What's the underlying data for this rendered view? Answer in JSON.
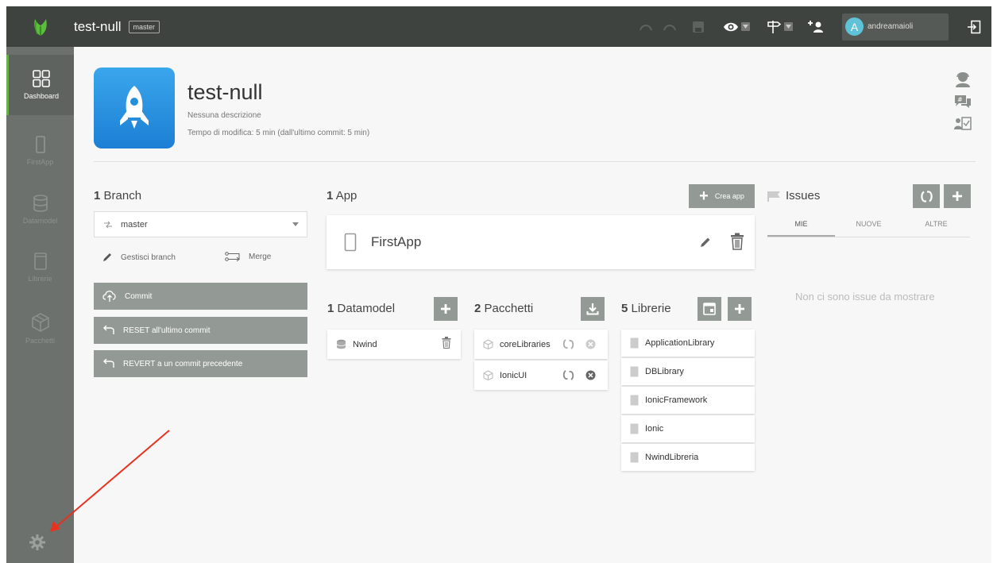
{
  "topbar": {
    "project_title": "test-null",
    "branch_badge": "master",
    "user_initial": "A",
    "username": "andreamaioli"
  },
  "sidebar": {
    "items": [
      {
        "label": "Dashboard",
        "icon": "grid-icon",
        "active": true
      },
      {
        "label": "FirstApp",
        "icon": "phone-icon"
      },
      {
        "label": "Datamodel",
        "icon": "database-icon"
      },
      {
        "label": "Librerie",
        "icon": "book-icon"
      },
      {
        "label": "Pacchetti",
        "icon": "package-icon"
      }
    ],
    "settings_icon": "gear-icon"
  },
  "header": {
    "title": "test-null",
    "description": "Nessuna descrizione",
    "time": "Tempo di modifica: 5 min (dall'ultimo commit: 5 min)"
  },
  "branch": {
    "count": "1",
    "title": "Branch",
    "selected": "master",
    "manage_label": "Gestisci branch",
    "merge_label": "Merge",
    "commit_label": "Commit",
    "reset_label": "RESET all'ultimo commit",
    "revert_label": "REVERT a un commit precedente"
  },
  "app": {
    "count": "1",
    "title": "App",
    "create_label": "Crea app",
    "name": "FirstApp"
  },
  "datamodel": {
    "count": "1",
    "title": "Datamodel",
    "items": [
      "Nwind"
    ]
  },
  "pacchetti": {
    "count": "2",
    "title": "Pacchetti",
    "items": [
      "coreLibraries",
      "IonicUI"
    ]
  },
  "librerie": {
    "count": "5",
    "title": "Librerie",
    "items": [
      "ApplicationLibrary",
      "DBLibrary",
      "IonicFramework",
      "Ionic",
      "NwindLibreria"
    ]
  },
  "issues": {
    "title": "Issues",
    "tabs": [
      "MIE",
      "NUOVE",
      "ALTRE"
    ],
    "empty_message": "Non ci sono issue da mostrare"
  },
  "colors": {
    "topbar": "#3e4340",
    "sidebar": "#6c716e",
    "button": "#939a95",
    "accent": "#6ab04c",
    "annotation_arrow": "#e8321f"
  }
}
